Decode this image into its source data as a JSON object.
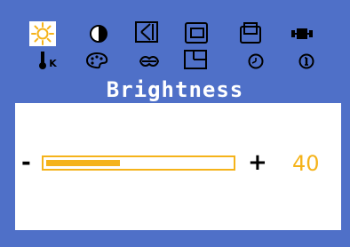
{
  "window": {
    "title": "Brightness"
  },
  "menu": {
    "selected": "brightness",
    "row1": [
      {
        "name": "brightness-icon"
      },
      {
        "name": "contrast-icon"
      },
      {
        "name": "h-position-icon"
      },
      {
        "name": "v-position-icon"
      },
      {
        "name": "image-size-icon"
      },
      {
        "name": "input-source-icon"
      }
    ],
    "row2": [
      {
        "name": "color-temperature-icon",
        "label": "K"
      },
      {
        "name": "color-palette-icon"
      },
      {
        "name": "sharpness-icon"
      },
      {
        "name": "frame-icon"
      },
      {
        "name": "clock-icon"
      },
      {
        "name": "information-icon"
      }
    ]
  },
  "control": {
    "minus_label": "-",
    "plus_label": "+",
    "value": "40",
    "level_fraction": 0.4
  },
  "colors": {
    "background": "#4f70c8",
    "accent": "#f5b31a",
    "panel": "#ffffff"
  }
}
